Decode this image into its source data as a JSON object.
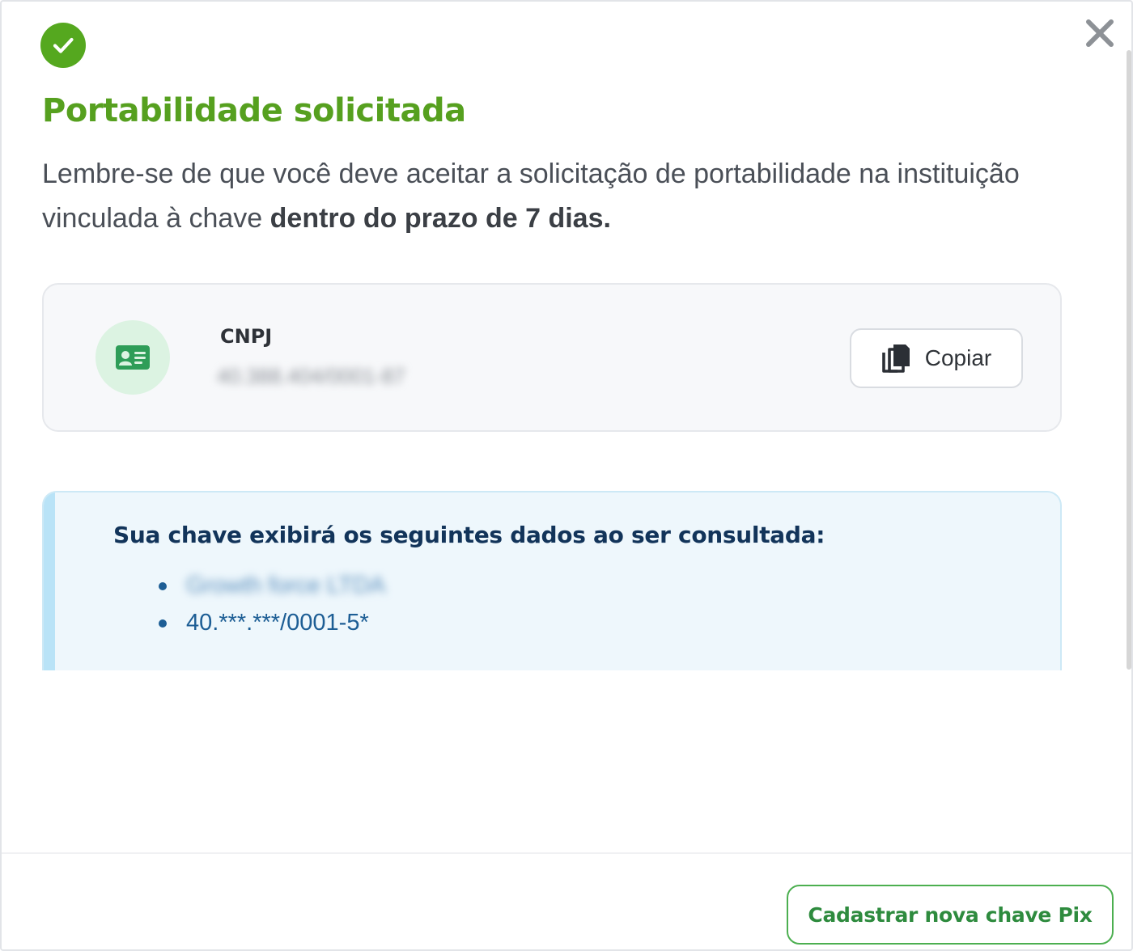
{
  "modal": {
    "title": "Portabilidade solicitada",
    "description_regular": "Lembre-se de que você deve aceitar a solicitação de portabilidade na instituição vinculada à chave ",
    "description_bold": "dentro do prazo de 7 dias.",
    "icons": {
      "success": "check-circle-icon",
      "close": "close-icon"
    }
  },
  "key_card": {
    "type_label": "CNPJ",
    "value_masked": "40.388.404/0001-87",
    "avatar_icon": "id-card-icon",
    "copy_label": "Copiar",
    "copy_icon": "copy-icon"
  },
  "info": {
    "title": "Sua chave exibirá os seguintes dados ao ser consultada:",
    "items": [
      "Growth force LTDA",
      "40.***.***/0001-5*"
    ]
  },
  "footer": {
    "new_key_label": "Cadastrar nova chave Pix"
  },
  "colors": {
    "success_green": "#55a81f",
    "title_green": "#56a01f",
    "button_green": "#2e8b3e",
    "info_background": "#eef7fc",
    "info_text": "#1d5e95"
  }
}
